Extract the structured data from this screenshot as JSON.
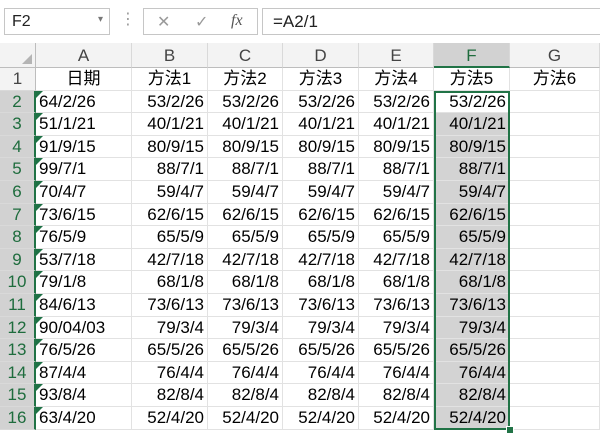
{
  "formula_bar": {
    "name_box": "F2",
    "name_box_arrow": "▾",
    "cancel_icon": "✕",
    "enter_icon": "✓",
    "fx_label": "fx",
    "formula": "=A2/1"
  },
  "columns": [
    "A",
    "B",
    "C",
    "D",
    "E",
    "F",
    "G"
  ],
  "selected_column": "F",
  "header_row": [
    "日期",
    "方法1",
    "方法2",
    "方法3",
    "方法4",
    "方法5",
    "方法6"
  ],
  "rows": [
    {
      "num": "2",
      "cells": [
        "64/2/26",
        "53/2/26",
        "53/2/26",
        "53/2/26",
        "53/2/26",
        "53/2/26",
        ""
      ]
    },
    {
      "num": "3",
      "cells": [
        "51/1/21",
        "40/1/21",
        "40/1/21",
        "40/1/21",
        "40/1/21",
        "40/1/21",
        ""
      ]
    },
    {
      "num": "4",
      "cells": [
        "91/9/15",
        "80/9/15",
        "80/9/15",
        "80/9/15",
        "80/9/15",
        "80/9/15",
        ""
      ]
    },
    {
      "num": "5",
      "cells": [
        "99/7/1",
        "88/7/1",
        "88/7/1",
        "88/7/1",
        "88/7/1",
        "88/7/1",
        ""
      ]
    },
    {
      "num": "6",
      "cells": [
        "70/4/7",
        "59/4/7",
        "59/4/7",
        "59/4/7",
        "59/4/7",
        "59/4/7",
        ""
      ]
    },
    {
      "num": "7",
      "cells": [
        "73/6/15",
        "62/6/15",
        "62/6/15",
        "62/6/15",
        "62/6/15",
        "62/6/15",
        ""
      ]
    },
    {
      "num": "8",
      "cells": [
        "76/5/9",
        "65/5/9",
        "65/5/9",
        "65/5/9",
        "65/5/9",
        "65/5/9",
        ""
      ]
    },
    {
      "num": "9",
      "cells": [
        "53/7/18",
        "42/7/18",
        "42/7/18",
        "42/7/18",
        "42/7/18",
        "42/7/18",
        ""
      ]
    },
    {
      "num": "10",
      "cells": [
        "79/1/8",
        "68/1/8",
        "68/1/8",
        "68/1/8",
        "68/1/8",
        "68/1/8",
        ""
      ]
    },
    {
      "num": "11",
      "cells": [
        "84/6/13",
        "73/6/13",
        "73/6/13",
        "73/6/13",
        "73/6/13",
        "73/6/13",
        ""
      ]
    },
    {
      "num": "12",
      "cells": [
        "90/04/03",
        "79/3/4",
        "79/3/4",
        "79/3/4",
        "79/3/4",
        "79/3/4",
        ""
      ]
    },
    {
      "num": "13",
      "cells": [
        "76/5/26",
        "65/5/26",
        "65/5/26",
        "65/5/26",
        "65/5/26",
        "65/5/26",
        ""
      ]
    },
    {
      "num": "14",
      "cells": [
        "87/4/4",
        "76/4/4",
        "76/4/4",
        "76/4/4",
        "76/4/4",
        "76/4/4",
        ""
      ]
    },
    {
      "num": "15",
      "cells": [
        "93/8/4",
        "82/8/4",
        "82/8/4",
        "82/8/4",
        "82/8/4",
        "82/8/4",
        ""
      ]
    },
    {
      "num": "16",
      "cells": [
        "63/4/20",
        "52/4/20",
        "52/4/20",
        "52/4/20",
        "52/4/20",
        "52/4/20",
        ""
      ]
    }
  ],
  "header_row_num": "1",
  "colors": {
    "accent": "#217346",
    "selection_fill": "#d3d3d3",
    "header_fill": "#f3f3f3",
    "error_triangle": "#1e7145"
  }
}
